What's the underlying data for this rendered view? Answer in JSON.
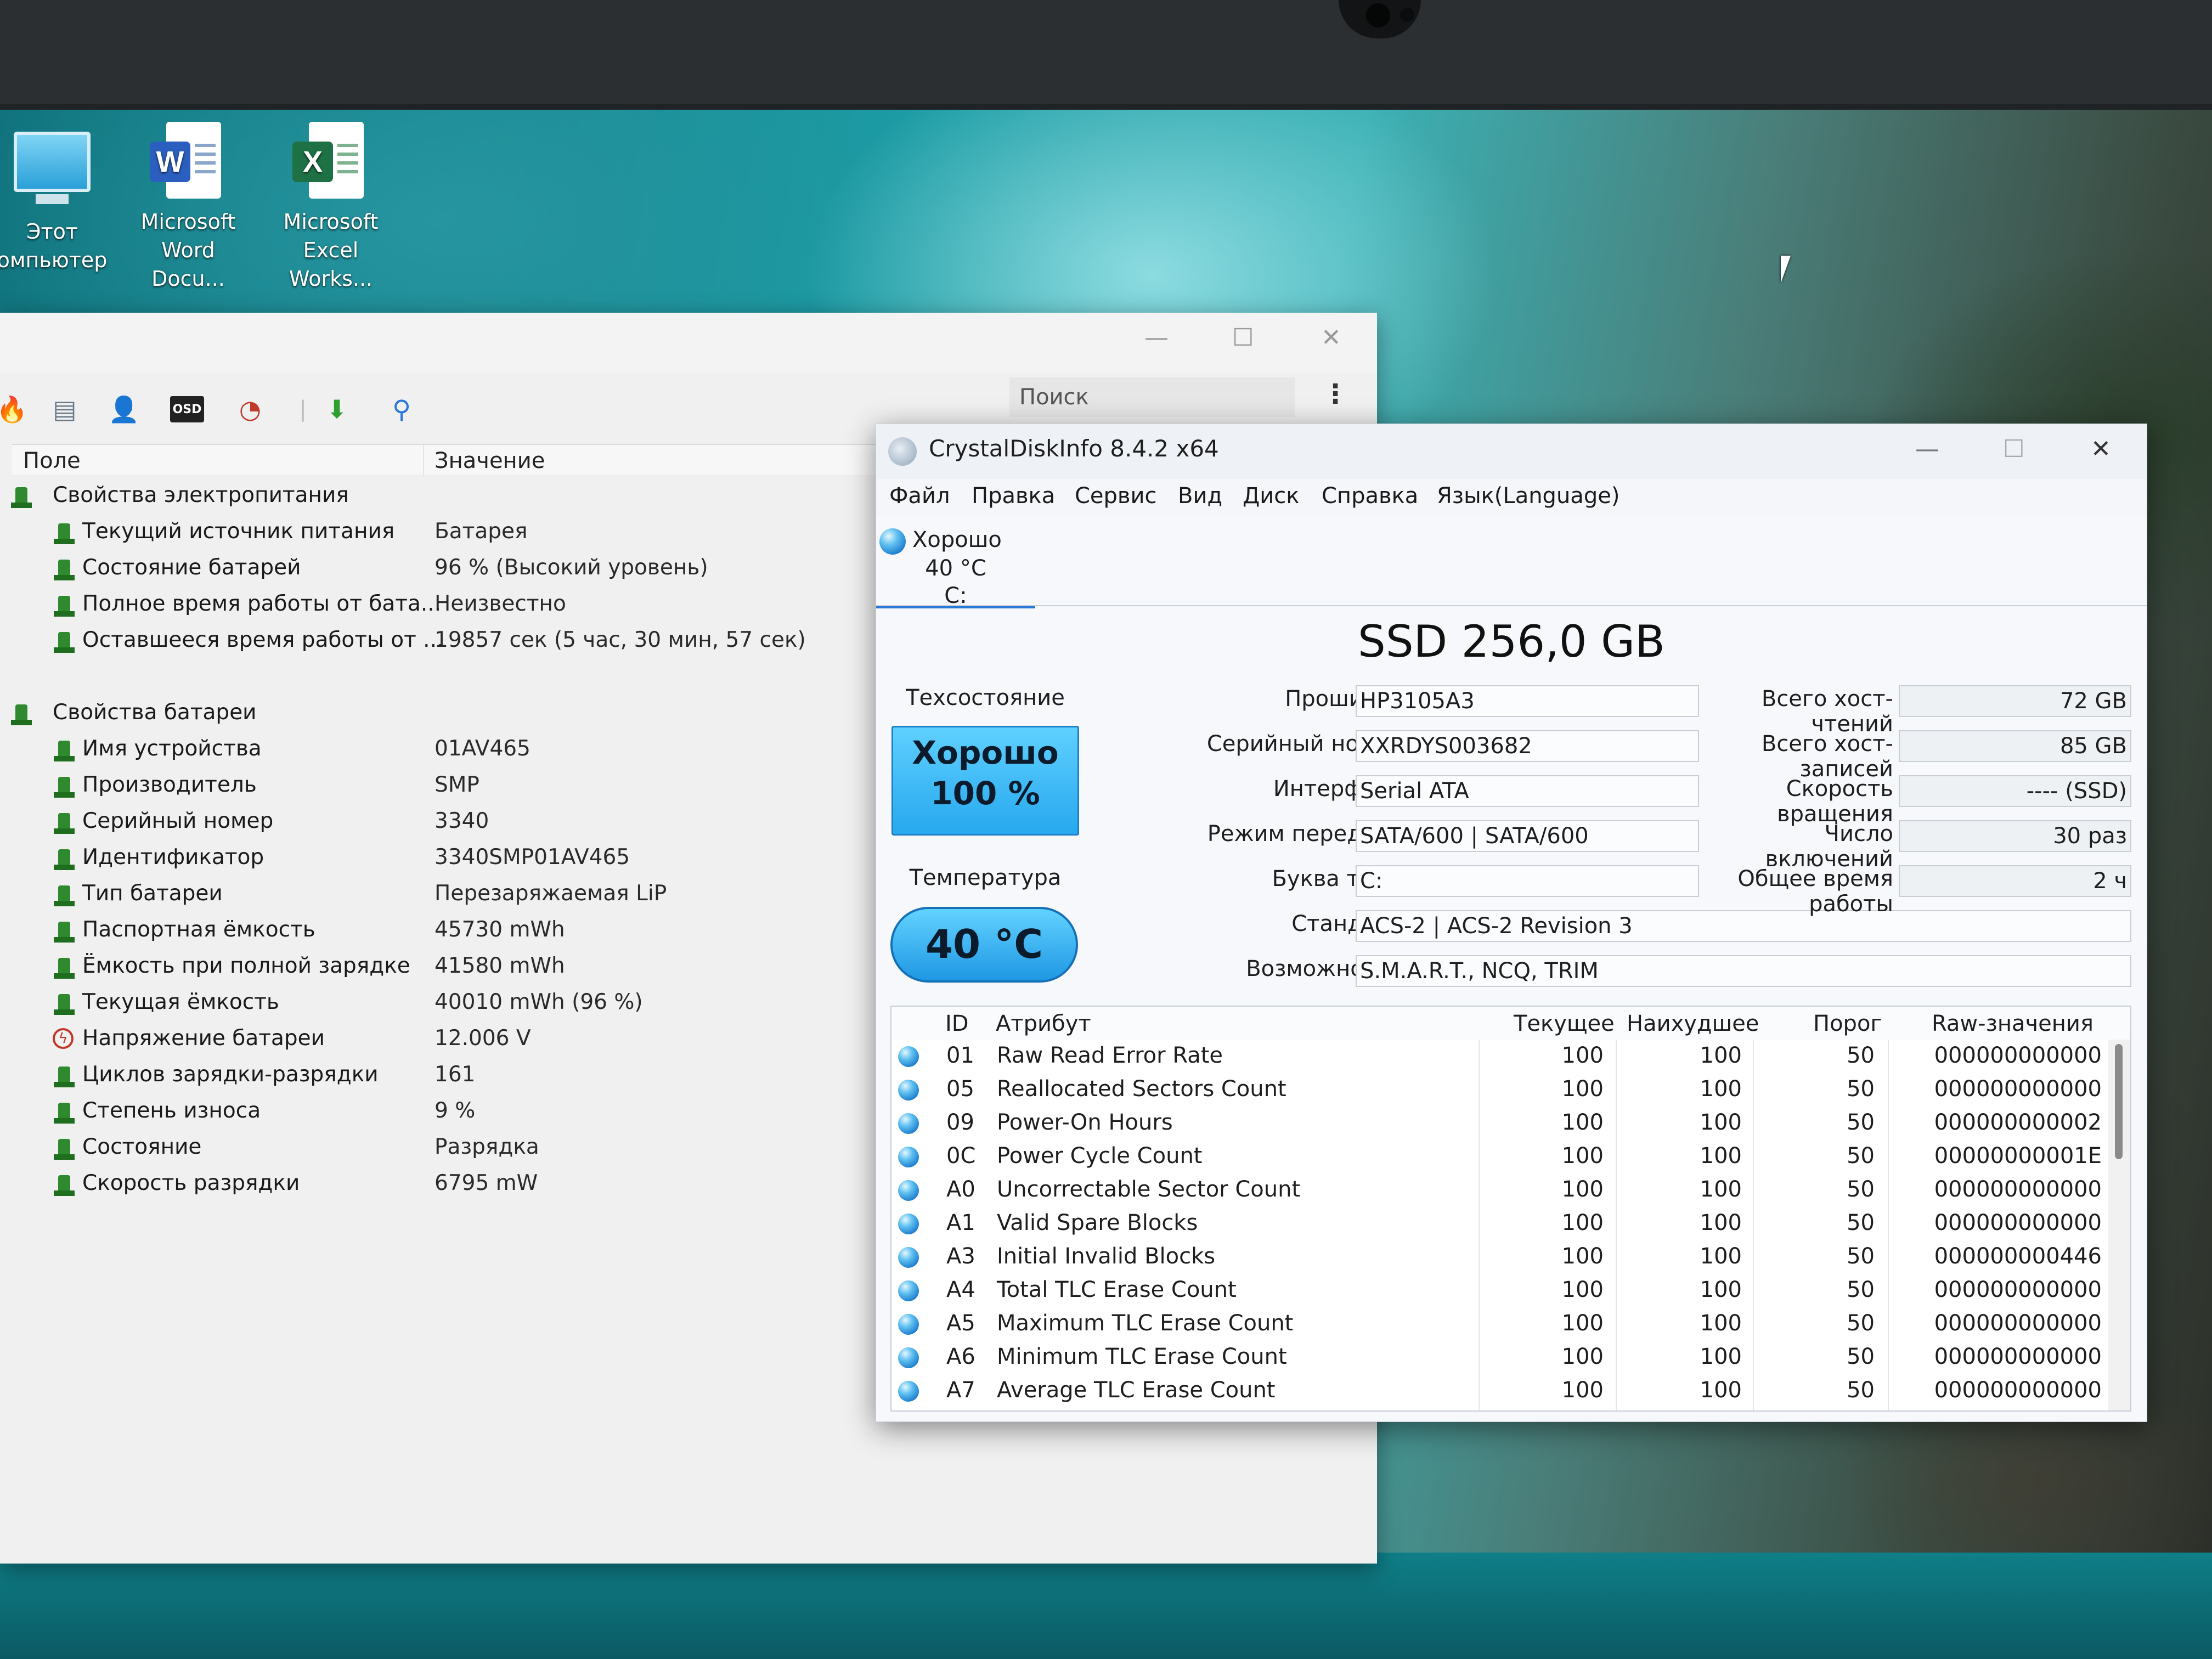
{
  "desktop": {
    "icons": [
      {
        "label_line1": "Этот",
        "label_line2": "омпьютер"
      },
      {
        "label_line1": "Microsoft",
        "label_line2": "Word Docu..."
      },
      {
        "label_line1": "Microsoft",
        "label_line2": "Excel Works..."
      }
    ]
  },
  "aida": {
    "window_controls": {
      "minimize": "—",
      "maximize": "☐",
      "close": "✕"
    },
    "search_placeholder": "Поиск",
    "columns": {
      "field": "Поле",
      "value": "Значение"
    },
    "groups": [
      {
        "title": "Свойства электропитания",
        "rows": [
          {
            "field": "Текущий источник питания",
            "value": "Батарея"
          },
          {
            "field": "Состояние батарей",
            "value": "96 % (Высокий уровень)"
          },
          {
            "field": "Полное время работы от бата...",
            "value": "Неизвестно"
          },
          {
            "field": "Оставшееся время работы от ...",
            "value": "19857 сек (5 час, 30 мин, 57 сек)"
          }
        ]
      },
      {
        "title": "Свойства батареи",
        "rows": [
          {
            "field": "Имя устройства",
            "value": "01AV465"
          },
          {
            "field": "Производитель",
            "value": "SMP"
          },
          {
            "field": "Серийный номер",
            "value": "3340"
          },
          {
            "field": "Идентификатор",
            "value": "3340SMP01AV465"
          },
          {
            "field": "Тип батареи",
            "value": "Перезаряжаемая LiP"
          },
          {
            "field": "Паспортная ёмкость",
            "value": "45730 mWh"
          },
          {
            "field": "Ёмкость при полной зарядке",
            "value": "41580 mWh"
          },
          {
            "field": "Текущая ёмкость",
            "value": "40010 mWh  (96 %)"
          },
          {
            "field": "Напряжение батареи",
            "value": "12.006 V"
          },
          {
            "field": "Циклов зарядки-разрядки",
            "value": "161"
          },
          {
            "field": "Степень износа",
            "value": "9 %"
          },
          {
            "field": "Состояние",
            "value": "Разрядка"
          },
          {
            "field": "Скорость разрядки",
            "value": "6795 mW"
          }
        ]
      }
    ]
  },
  "cdi": {
    "title": "CrystalDiskInfo 8.4.2 x64",
    "menu": [
      "Файл",
      "Правка",
      "Сервис",
      "Вид",
      "Диск",
      "Справка",
      "Язык(Language)"
    ],
    "disk_tab": {
      "status": "Хорошо",
      "temp": "40 °C",
      "letter": "C:"
    },
    "disk_title": "SSD 256,0 GB",
    "health_label": "Техсостояние",
    "health_status": "Хорошо",
    "health_percent": "100 %",
    "temp_label": "Температура",
    "temp_value": "40 °C",
    "info": [
      {
        "label": "Прошивка",
        "value": "HP3105A3"
      },
      {
        "label": "Серийный номер",
        "value": "XXRDYS003682"
      },
      {
        "label": "Интерфейс",
        "value": "Serial ATA"
      },
      {
        "label": "Режим передачи",
        "value": "SATA/600 | SATA/600"
      },
      {
        "label": "Буква тома",
        "value": "C:"
      },
      {
        "label": "Стандарт",
        "value": "ACS-2 | ACS-2 Revision 3"
      },
      {
        "label": "Возможности",
        "value": "S.M.A.R.T., NCQ, TRIM"
      }
    ],
    "stats": [
      {
        "label": "Всего хост-чтений",
        "value": "72 GB"
      },
      {
        "label": "Всего хост-записей",
        "value": "85 GB"
      },
      {
        "label": "Скорость вращения",
        "value": "---- (SSD)"
      },
      {
        "label": "Число включений",
        "value": "30 раз"
      },
      {
        "label": "Общее время работы",
        "value": "2 ч"
      }
    ],
    "smart_headers": {
      "id": "ID",
      "attr": "Атрибут",
      "current": "Текущее",
      "worst": "Наихудшее",
      "threshold": "Порог",
      "raw": "Raw-значения"
    },
    "smart_rows": [
      {
        "id": "01",
        "attr": "Raw Read Error Rate",
        "current": "100",
        "worst": "100",
        "threshold": "50",
        "raw": "000000000000"
      },
      {
        "id": "05",
        "attr": "Reallocated Sectors Count",
        "current": "100",
        "worst": "100",
        "threshold": "50",
        "raw": "000000000000"
      },
      {
        "id": "09",
        "attr": "Power-On Hours",
        "current": "100",
        "worst": "100",
        "threshold": "50",
        "raw": "000000000002"
      },
      {
        "id": "0C",
        "attr": "Power Cycle Count",
        "current": "100",
        "worst": "100",
        "threshold": "50",
        "raw": "00000000001E"
      },
      {
        "id": "A0",
        "attr": "Uncorrectable Sector Count",
        "current": "100",
        "worst": "100",
        "threshold": "50",
        "raw": "000000000000"
      },
      {
        "id": "A1",
        "attr": "Valid Spare Blocks",
        "current": "100",
        "worst": "100",
        "threshold": "50",
        "raw": "000000000000"
      },
      {
        "id": "A3",
        "attr": "Initial Invalid Blocks",
        "current": "100",
        "worst": "100",
        "threshold": "50",
        "raw": "000000000446"
      },
      {
        "id": "A4",
        "attr": "Total TLC Erase Count",
        "current": "100",
        "worst": "100",
        "threshold": "50",
        "raw": "000000000000"
      },
      {
        "id": "A5",
        "attr": "Maximum TLC Erase Count",
        "current": "100",
        "worst": "100",
        "threshold": "50",
        "raw": "000000000000"
      },
      {
        "id": "A6",
        "attr": "Minimum TLC Erase Count",
        "current": "100",
        "worst": "100",
        "threshold": "50",
        "raw": "000000000000"
      },
      {
        "id": "A7",
        "attr": "Average TLC Erase Count",
        "current": "100",
        "worst": "100",
        "threshold": "50",
        "raw": "000000000000"
      }
    ],
    "window_controls": {
      "minimize": "—",
      "maximize": "☐",
      "close": "✕"
    }
  }
}
